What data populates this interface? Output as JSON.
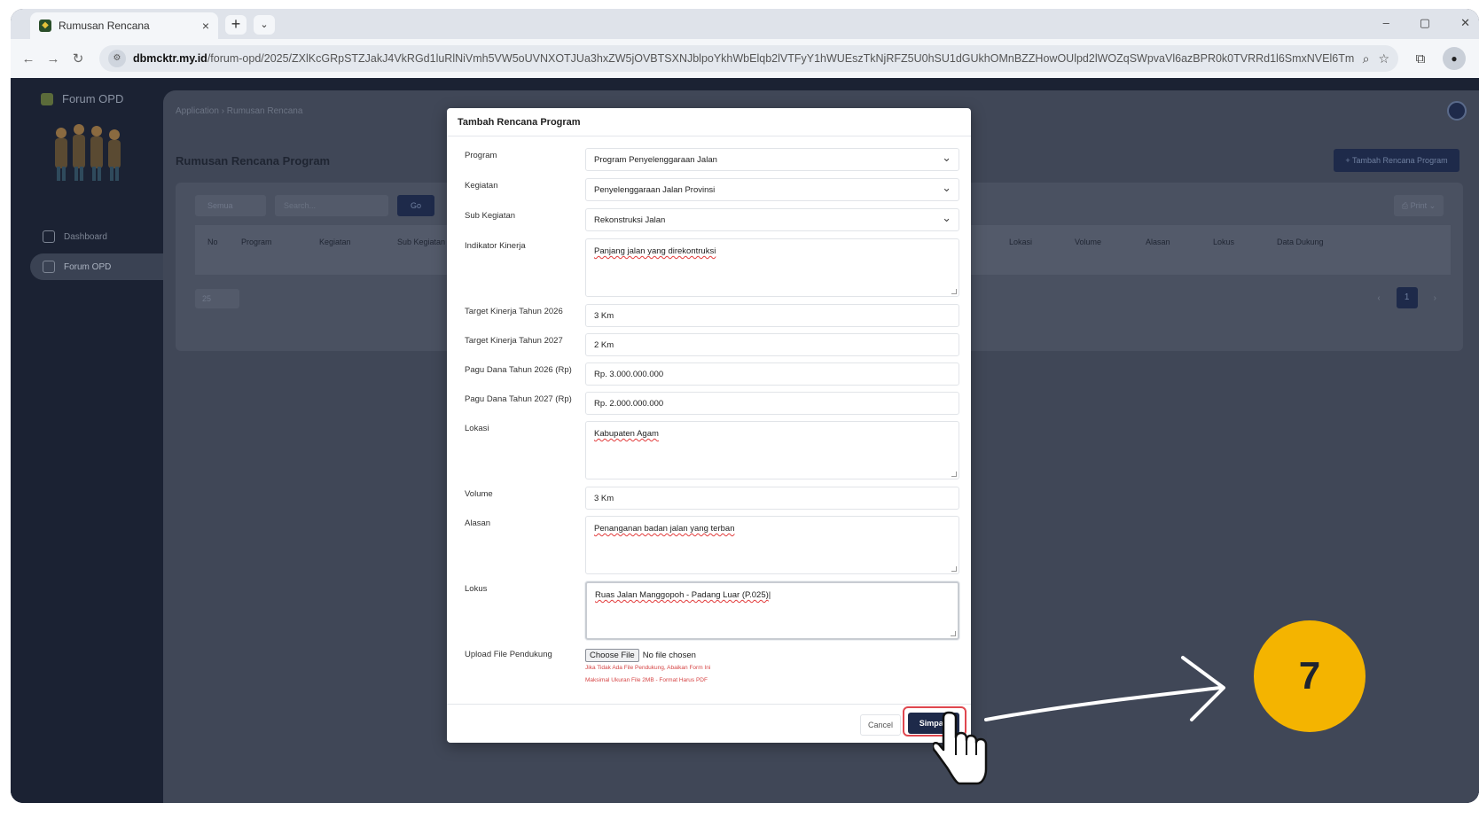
{
  "browser": {
    "tab_title": "Rumusan Rencana",
    "tab_close": "×",
    "new_tab": "+",
    "tab_menu": "⌄",
    "url_host": "dbmcktr.my.id",
    "url_path": "/forum-opd/2025/ZXlKcGRpSTZJakJ4VkRGd1luRlNiVmh5VW5oUVNXOTJUa3hxZW5jOVBTSXNJblpoYkhWbElqb2lVTFyY1hWUEszTkNjRFZ5U0hSU1dGUkhOMnBZZHowOUlpd2lWOZqSWpvaVl6azBPR0k0TVRRd1l6SmxNVEl6TmpKaE1ETTJP...",
    "win_min": "–",
    "win_max": "▢",
    "win_close": "✕"
  },
  "app": {
    "brand": "Forum OPD",
    "sidebar": [
      {
        "label": "Dashboard",
        "active": false
      },
      {
        "label": "Forum OPD",
        "active": true
      }
    ],
    "breadcrumb": "Application  ›  Rumusan Rencana",
    "page_title": "Rumusan Rencana Program",
    "add_button": "+  Tambah Rencana Program",
    "filter_value": "Semua",
    "search_placeholder": "Search...",
    "go_label": "Go",
    "print_label": "⎙  Print  ⌄",
    "table_headers": [
      "No",
      "Program",
      "Kegiatan",
      "Sub Kegiatan",
      "Lokasi",
      "Volume",
      "Alasan",
      "Lokus",
      "Data Dukung"
    ],
    "per_page": "25",
    "pagination": {
      "prev": "‹",
      "current": "1",
      "next": "›"
    }
  },
  "modal": {
    "title": "Tambah Rencana Program",
    "labels": {
      "program": "Program",
      "kegiatan": "Kegiatan",
      "sub_kegiatan": "Sub Kegiatan",
      "indikator": "Indikator Kinerja",
      "target_2026": "Target Kinerja Tahun 2026",
      "target_2027": "Target Kinerja Tahun 2027",
      "pagu_2026": "Pagu Dana Tahun 2026 (Rp)",
      "pagu_2027": "Pagu Dana Tahun 2027 (Rp)",
      "lokasi": "Lokasi",
      "volume": "Volume",
      "alasan": "Alasan",
      "lokus": "Lokus",
      "upload": "Upload File Pendukung"
    },
    "values": {
      "program": "Program Penyelenggaraan Jalan",
      "kegiatan": "Penyelenggaraan Jalan Provinsi",
      "sub_kegiatan": "Rekonstruksi Jalan",
      "indikator": "Panjang jalan yang direkontruksi",
      "target_2026": "3 Km",
      "target_2027": "2 Km",
      "pagu_2026": "Rp. 3.000.000.000",
      "pagu_2027": "Rp. 2.000.000.000",
      "lokasi": "Kabupaten Agam",
      "volume": "3 Km",
      "alasan": "Penanganan badan jalan yang terban",
      "lokus": "Ruas Jalan Manggopoh - Padang Luar (P.025)"
    },
    "upload": {
      "button": "Choose File",
      "status": "No file chosen",
      "hint1": "Jika Tidak Ada File Pendukung, Abaikan Form Ini",
      "hint2": "Maksimal Ukuran File 2MB - Format Harus PDF"
    },
    "cancel": "Cancel",
    "save": "Simpan"
  },
  "annotation": {
    "step": "7",
    "badge_color": "#F4B400",
    "highlight_color": "#E0474F"
  }
}
